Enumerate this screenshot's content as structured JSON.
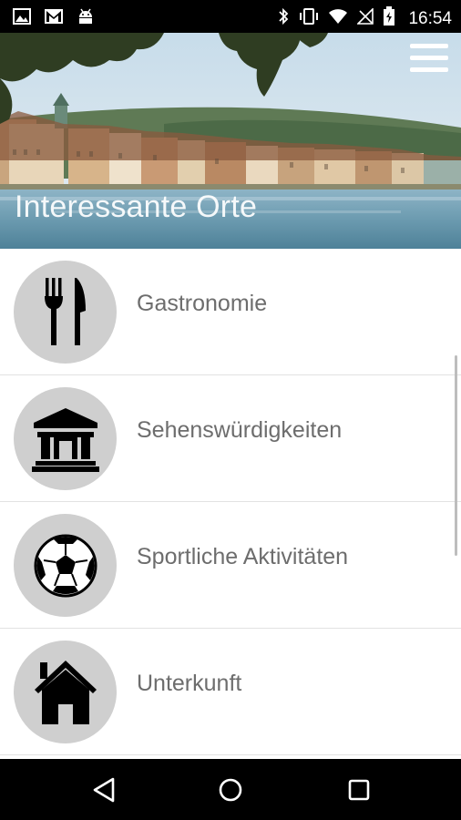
{
  "status_bar": {
    "time": "16:54",
    "left_icons": [
      "image-icon",
      "gmail-icon",
      "android-icon"
    ],
    "right_icons": [
      "bluetooth-icon",
      "vibrate-icon",
      "wifi-icon",
      "no-signal-icon",
      "battery-charging-icon"
    ]
  },
  "header": {
    "title": "Interessante Orte",
    "menu_icon": "hamburger-menu-icon"
  },
  "list": {
    "items": [
      {
        "label": "Gastronomie",
        "icon": "fork-knife-icon"
      },
      {
        "label": "Sehenswürdigkeiten",
        "icon": "museum-building-icon"
      },
      {
        "label": "Sportliche Aktivitäten",
        "icon": "soccer-ball-icon"
      },
      {
        "label": "Unterkunft",
        "icon": "house-icon"
      }
    ]
  },
  "nav_bar": {
    "buttons": [
      "back-icon",
      "home-icon",
      "recents-icon"
    ]
  },
  "colors": {
    "status_bar": "#000000",
    "circle_bg": "#cfcfcf",
    "label_text": "#6d6d6d",
    "divider": "#e2e2e2"
  }
}
